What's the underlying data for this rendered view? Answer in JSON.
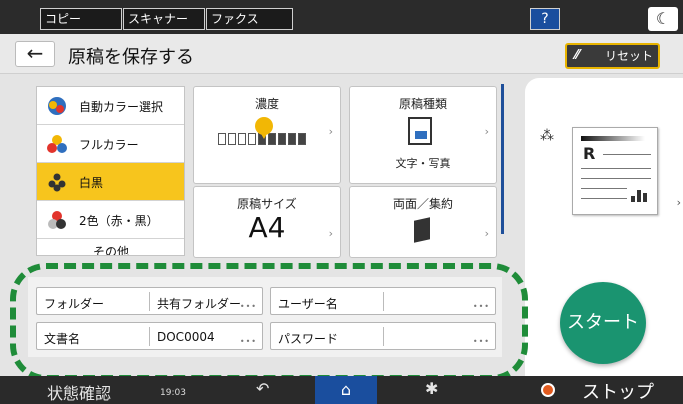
{
  "topbar": {
    "tabs": [
      {
        "label": "コピー"
      },
      {
        "label": "スキャナー"
      },
      {
        "label": "ファクス"
      }
    ],
    "help_label": "?",
    "theme_icon": "moon-icon"
  },
  "header": {
    "back_icon": "arrow-left-icon",
    "title": "原稿を保存する",
    "reset_label": "リセット"
  },
  "color_modes": [
    {
      "label": "自動カラー選択",
      "icon": "auto-color-icon",
      "selected": false
    },
    {
      "label": "フルカラー",
      "icon": "full-color-icon",
      "selected": false
    },
    {
      "label": "白黒",
      "icon": "black-white-icon",
      "selected": true
    },
    {
      "label": "2色（赤・黒）",
      "icon": "two-color-icon",
      "selected": false
    },
    {
      "label": "その他",
      "icon": "",
      "selected": false
    }
  ],
  "tiles": {
    "density": {
      "title": "濃度",
      "level": 5,
      "steps": 9
    },
    "original_type": {
      "title": "原稿種類",
      "value": "文字・写真"
    },
    "original_size": {
      "title": "原稿サイズ",
      "value": "A4"
    },
    "duplex": {
      "title": "両面／集約"
    }
  },
  "info": {
    "folder": {
      "label": "フォルダー",
      "value": "共有フォルダー"
    },
    "user": {
      "label": "ユーザー名",
      "value": ""
    },
    "doc_name": {
      "label": "文書名",
      "value": "DOC0004"
    },
    "password": {
      "label": "パスワード",
      "value": ""
    }
  },
  "start_label": "スタート",
  "bottom": {
    "status_label": "状態確認",
    "clock": "19:03",
    "stop_label": "ストップ"
  },
  "colors": {
    "accent": "#f7c51d",
    "start": "#1a9470",
    "home": "#1a4e9e",
    "highlight": "#1f8c39"
  }
}
